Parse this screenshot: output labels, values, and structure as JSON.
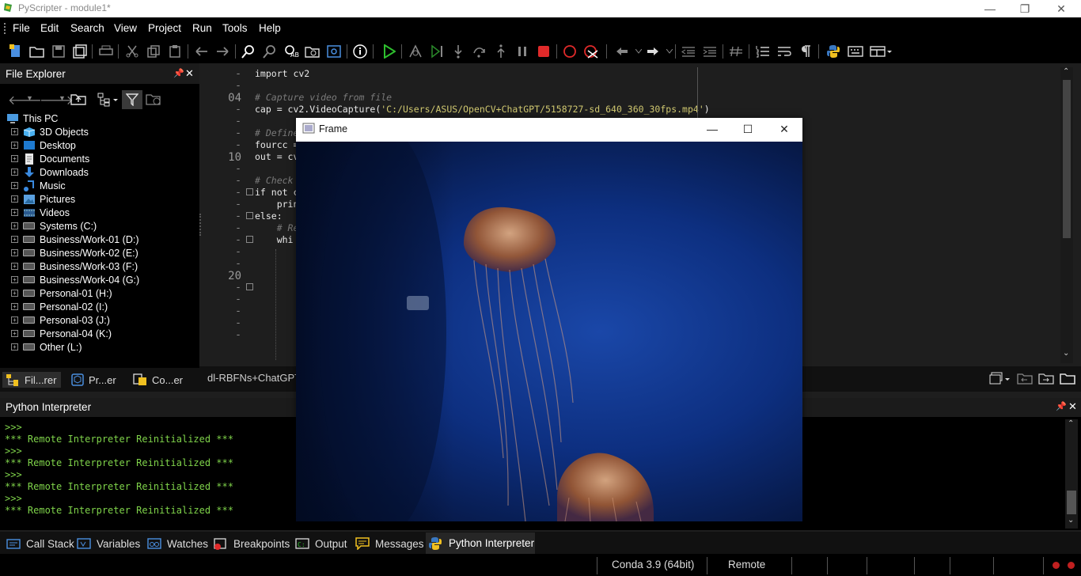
{
  "window": {
    "title": "PyScripter - module1*"
  },
  "menu": [
    "File",
    "Edit",
    "Search",
    "View",
    "Project",
    "Run",
    "Tools",
    "Help"
  ],
  "file_explorer": {
    "title": "File Explorer",
    "items": [
      {
        "label": "This PC",
        "icon": "computer-icon"
      },
      {
        "label": "3D Objects",
        "icon": "cube-icon"
      },
      {
        "label": "Desktop",
        "icon": "desktop-icon"
      },
      {
        "label": "Documents",
        "icon": "document-icon"
      },
      {
        "label": "Downloads",
        "icon": "download-icon"
      },
      {
        "label": "Music",
        "icon": "music-icon"
      },
      {
        "label": "Pictures",
        "icon": "picture-icon"
      },
      {
        "label": "Videos",
        "icon": "video-icon"
      },
      {
        "label": "Systems (C:)",
        "icon": "drive-icon"
      },
      {
        "label": "Business/Work-01 (D:)",
        "icon": "drive-icon"
      },
      {
        "label": "Business/Work-02 (E:)",
        "icon": "drive-icon"
      },
      {
        "label": "Business/Work-03 (F:)",
        "icon": "drive-icon"
      },
      {
        "label": "Business/Work-04 (G:)",
        "icon": "drive-icon"
      },
      {
        "label": "Personal-01 (H:)",
        "icon": "drive-icon"
      },
      {
        "label": "Personal-02 (I:)",
        "icon": "drive-icon"
      },
      {
        "label": "Personal-03 (J:)",
        "icon": "drive-icon"
      },
      {
        "label": "Personal-04 (K:)",
        "icon": "drive-icon"
      },
      {
        "label": "Other (L:)",
        "icon": "drive-icon"
      }
    ],
    "tabs": [
      "Fil...rer",
      "Pr...er",
      "Co...er"
    ]
  },
  "editor": {
    "line_numbers": [
      "-",
      "-",
      "04",
      "-",
      "-",
      "-",
      "-",
      "10",
      "-",
      "-",
      "-",
      "-",
      "-",
      "-",
      "-",
      "-",
      "-",
      "20",
      "-",
      "-",
      "-",
      "-",
      "-"
    ],
    "code": [
      {
        "text": "import cv2",
        "cls": "kw"
      },
      {
        "text": "",
        "cls": "kw"
      },
      {
        "text": "# Capture video from file",
        "cls": "cm"
      },
      {
        "text": "cap = cv2.VideoCapture(",
        "cls": "kw",
        "str": "'C:/Users/ASUS/OpenCV+ChatGPT/5158727-sd_640_360_30fps.mp4'",
        "tail": ")"
      },
      {
        "text": "",
        "cls": "kw"
      },
      {
        "text": "# Define",
        "cls": "cm"
      },
      {
        "text": "fourcc =",
        "cls": "kw"
      },
      {
        "text": "out = cv",
        "cls": "kw"
      },
      {
        "text": "",
        "cls": "kw"
      },
      {
        "text": "# Check",
        "cls": "cm"
      },
      {
        "text": "if not c",
        "cls": "kw"
      },
      {
        "text": "    prin",
        "cls": "kw"
      },
      {
        "text": "else:",
        "cls": "kw"
      },
      {
        "text": "    # Re",
        "cls": "cm"
      },
      {
        "text": "    whi",
        "cls": "kw"
      }
    ],
    "tab_label": "dl-RBFNs+ChatGPT"
  },
  "frame_window": {
    "title": "Frame"
  },
  "python_interpreter": {
    "title": "Python Interpreter",
    "lines": [
      ">>>",
      "*** Remote Interpreter Reinitialized ***",
      ">>>",
      "*** Remote Interpreter Reinitialized ***",
      ">>>",
      "*** Remote Interpreter Reinitialized ***",
      ">>>",
      "*** Remote Interpreter Reinitialized ***"
    ]
  },
  "bottom_tabs": [
    "Call Stack",
    "Variables",
    "Watches",
    "Breakpoints",
    "Output",
    "Messages",
    "Python Interpreter"
  ],
  "status": {
    "env": "Conda 3.9 (64bit)",
    "mode": "Remote"
  }
}
